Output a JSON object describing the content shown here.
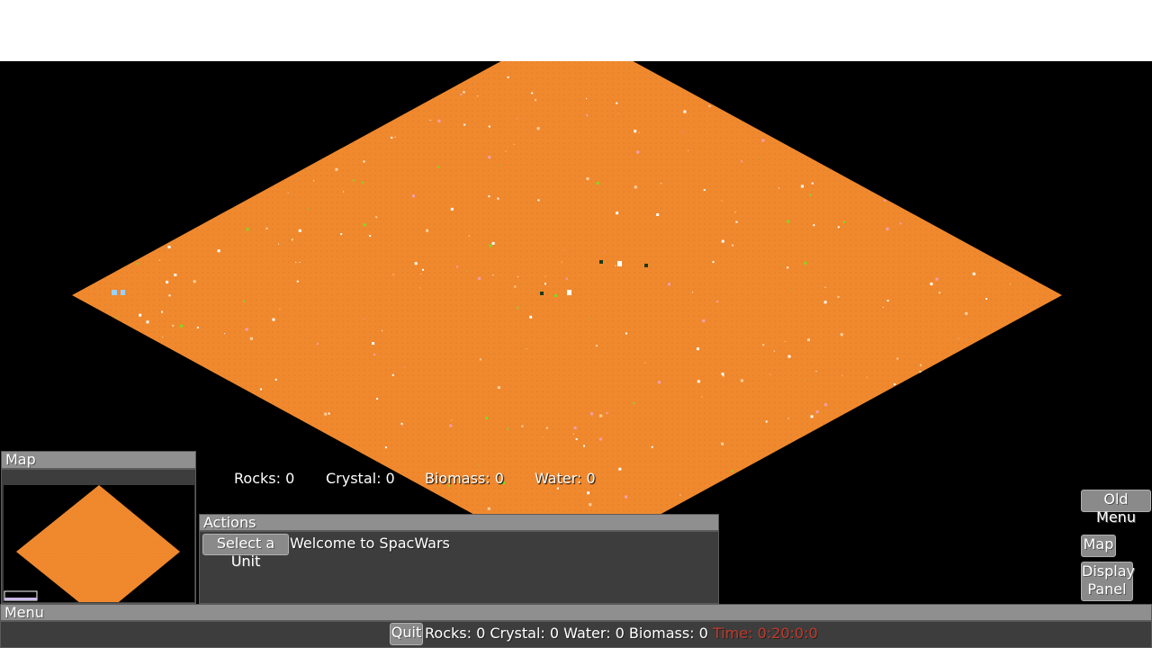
{
  "resources_top": {
    "rocks": "Rocks: 0",
    "crystal": "Crystal: 0",
    "biomass": "Biomass: 0",
    "water": "Water: 0"
  },
  "map_panel": {
    "title": "Map"
  },
  "actions_panel": {
    "title": "Actions",
    "select_unit_label": "Select a Unit",
    "message": "Welcome to SpacWars"
  },
  "right_buttons": {
    "old_menu": "Old Menu",
    "map": "Map",
    "display_panel_line1": "Display",
    "display_panel_line2": "Panel"
  },
  "menu_bar": {
    "title": "Menu",
    "quit_label": "Quit",
    "status": "Rocks: 0 Crystal: 0 Water: 0 Biomass: 0",
    "time": "Time: 0:20:0:0"
  },
  "colors": {
    "terrain": "#f0892e",
    "terrain_dark": "#e07d26",
    "time_text": "#c0392b",
    "speck_white": "#ffffff",
    "speck_green": "#7ddc1f",
    "speck_pink": "#f4a0b0"
  },
  "icons": {
    "units": "unit-sprite",
    "resources": "resource-speck"
  }
}
